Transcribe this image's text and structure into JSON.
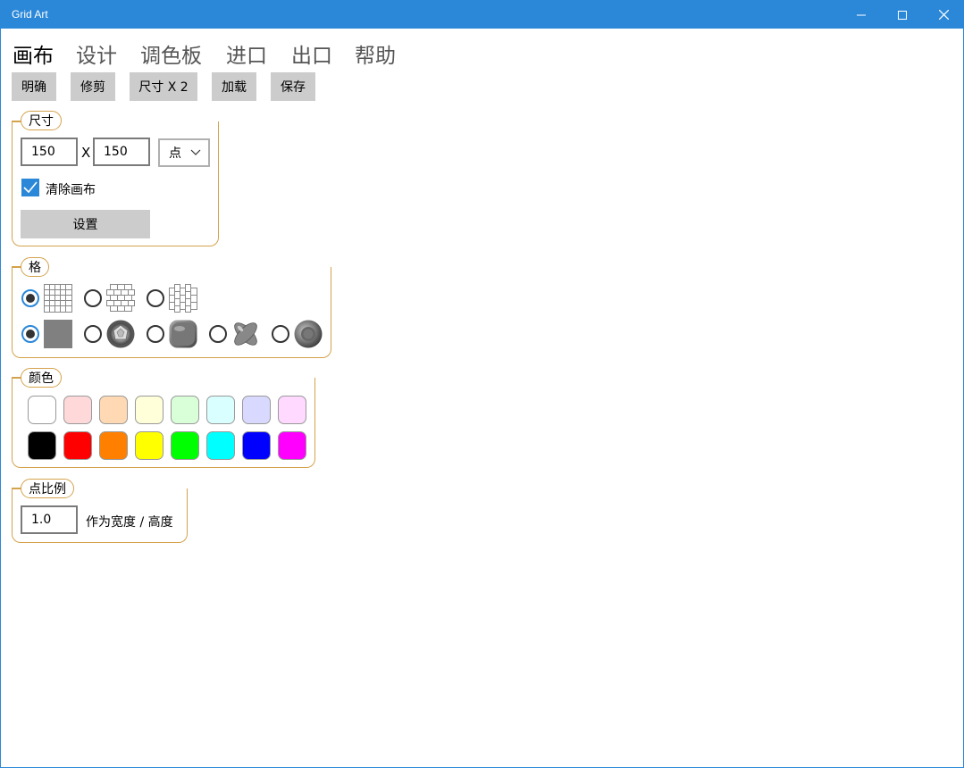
{
  "window": {
    "title": "Grid Art"
  },
  "tabs": [
    {
      "label": "画布",
      "active": true
    },
    {
      "label": "设计",
      "active": false
    },
    {
      "label": "调色板",
      "active": false
    },
    {
      "label": "进口",
      "active": false
    },
    {
      "label": "出口",
      "active": false
    },
    {
      "label": "帮助",
      "active": false
    }
  ],
  "toolbar": {
    "clear": "明确",
    "trim": "修剪",
    "size_x2": "尺寸 X 2",
    "load": "加载",
    "save": "保存"
  },
  "size_group": {
    "legend": "尺寸",
    "width_value": "150",
    "separator": "X",
    "height_value": "150",
    "unit_selected": "点",
    "clear_canvas_label": "清除画布",
    "clear_canvas_checked": true,
    "set_button": "设置"
  },
  "grid_group": {
    "legend": "格",
    "layout_options": [
      {
        "icon": "square-grid-icon",
        "selected": true
      },
      {
        "icon": "brick-grid-icon",
        "selected": false
      },
      {
        "icon": "vertical-brick-grid-icon",
        "selected": false
      }
    ],
    "cell_style_options": [
      {
        "icon": "flat-square-icon",
        "selected": true
      },
      {
        "icon": "gem-icon",
        "selected": false
      },
      {
        "icon": "rounded-tile-icon",
        "selected": false
      },
      {
        "icon": "cross-knot-icon",
        "selected": false
      },
      {
        "icon": "ring-icon",
        "selected": false
      }
    ]
  },
  "color_group": {
    "legend": "颜色",
    "light_colors": [
      "#ffffff",
      "#ffd9d9",
      "#ffd9b3",
      "#ffffd9",
      "#d9ffd9",
      "#d9ffff",
      "#d9d9ff",
      "#ffd9ff"
    ],
    "bright_colors": [
      "#000000",
      "#ff0000",
      "#ff8000",
      "#ffff00",
      "#00ff00",
      "#00ffff",
      "#0000ff",
      "#ff00ff"
    ]
  },
  "ratio_group": {
    "legend": "点比例",
    "ratio_value": "1.0",
    "ratio_label": "作为宽度 / 高度"
  },
  "colors": {
    "titlebar": "#2b88d8",
    "accent": "#2b88d8",
    "group_border": "#d4a24c"
  }
}
